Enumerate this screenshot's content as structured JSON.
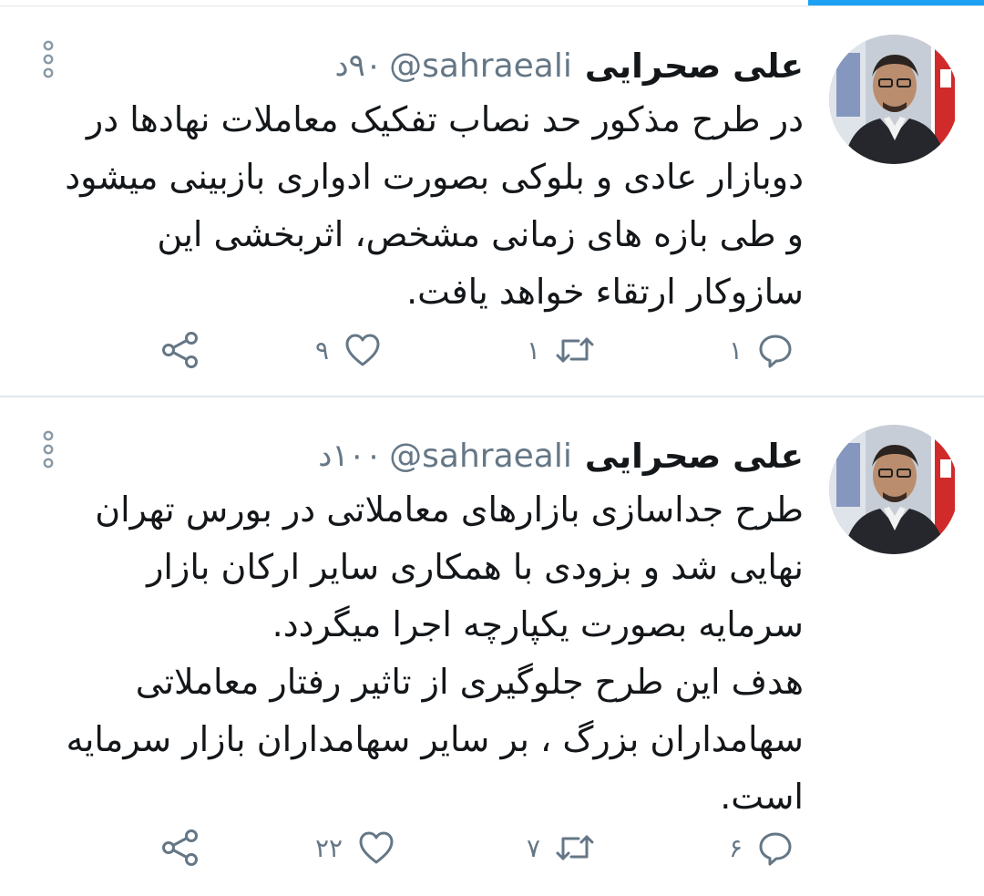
{
  "colors": {
    "accent": "#1da1f2",
    "text_primary": "#14171a",
    "text_secondary": "#657786",
    "divider": "#e1e8ed"
  },
  "tweets": [
    {
      "author_name": "علی صحرایی",
      "handle": "@sahraeali",
      "time": "۹۰د",
      "text": "در طرح مذکور حد نصاب تفکیک معاملات نهادها در دوبازار عادی و بلوکی بصورت ادواری بازبینی میشود و طی بازه های زمانی مشخص، اثربخشی این سازوکار ارتقاء خواهد یافت.",
      "reply_count": "۱",
      "retweet_count": "۱",
      "like_count": "۹",
      "icons": {
        "reply": "reply-icon",
        "retweet": "retweet-icon",
        "like": "heart-icon",
        "share": "share-icon",
        "more": "more-options-icon"
      }
    },
    {
      "author_name": "علی صحرایی",
      "handle": "@sahraeali",
      "time": "۱۰۰د",
      "text": "طرح جداسازی بازارهای معاملاتی در بورس تهران نهایی شد و بزودی با همکاری سایر ارکان بازار سرمایه بصورت یکپارچه اجرا میگردد.\nهدف این طرح جلوگیری از تاثیر رفتار معاملاتی سهامداران بزرگ ، بر سایر سهامداران بازار سرمایه است.",
      "reply_count": "۶",
      "retweet_count": "۷",
      "like_count": "۲۲",
      "icons": {
        "reply": "reply-icon",
        "retweet": "retweet-icon",
        "like": "heart-icon",
        "share": "share-icon",
        "more": "more-options-icon"
      }
    }
  ]
}
